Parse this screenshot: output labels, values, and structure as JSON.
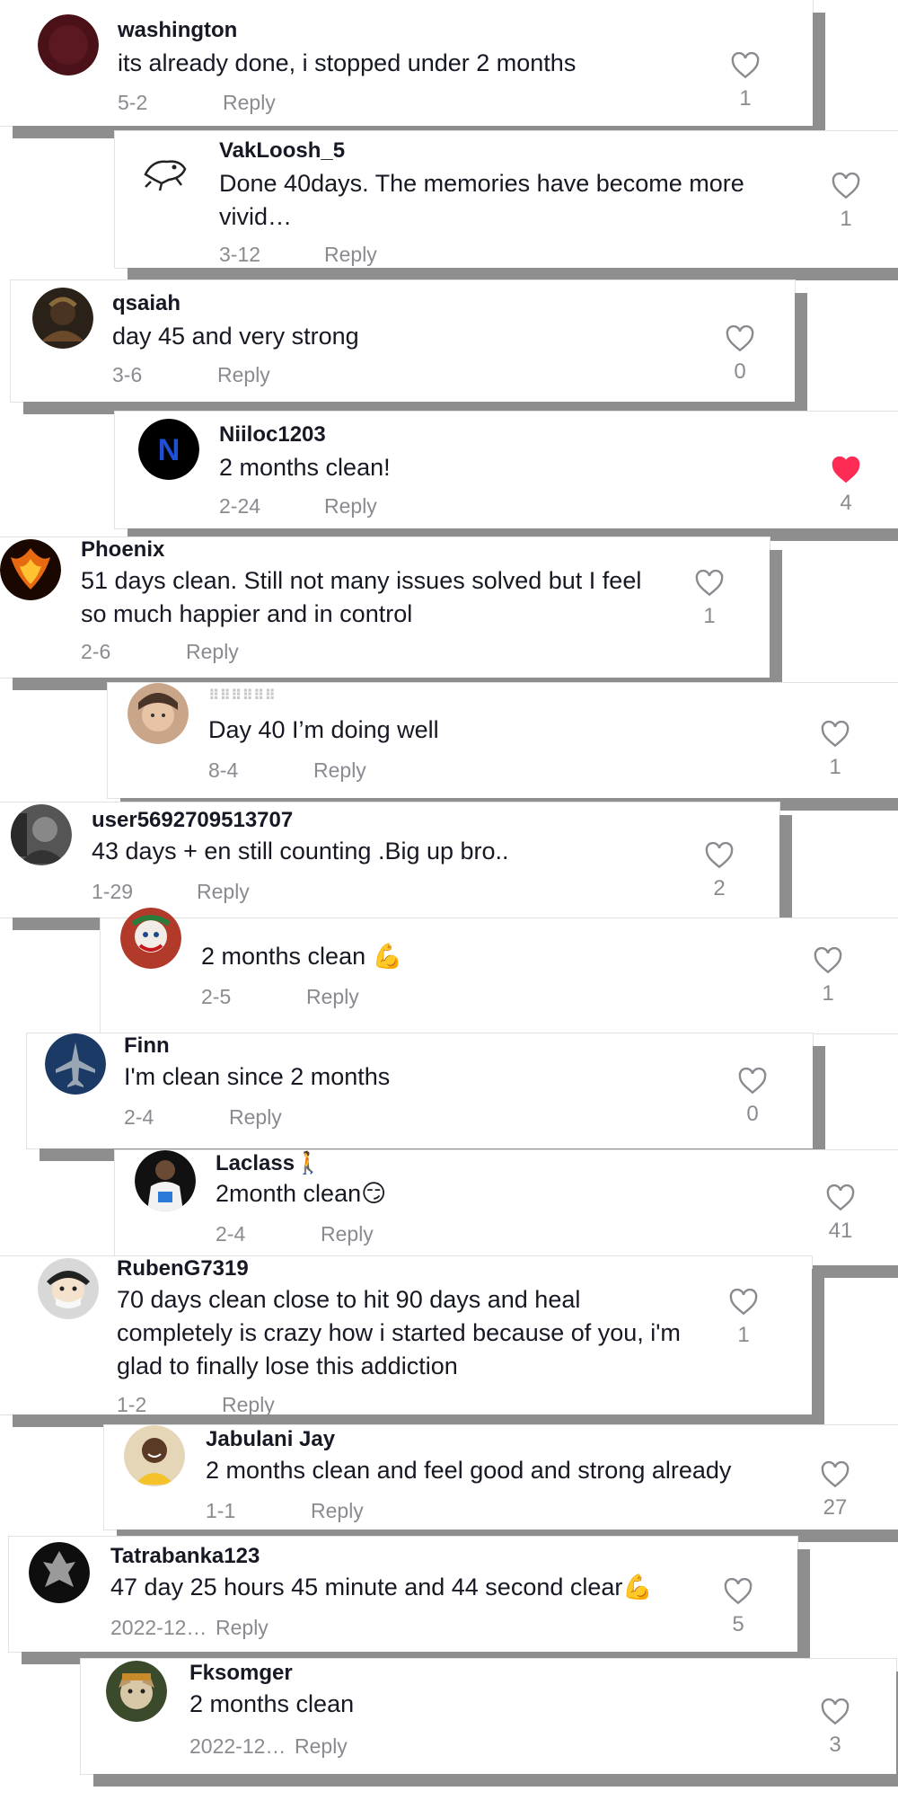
{
  "comments": [
    {
      "username": "washington",
      "text": "its already done, i stopped under 2 months",
      "date": "5-2",
      "reply": "Reply",
      "likes": "1",
      "liked": false,
      "avatar": "avatar-dark-red"
    },
    {
      "username": "VakLoosh_5",
      "text": "Done 40days. The memories have become more vivid…",
      "date": "3-12",
      "reply": "Reply",
      "likes": "1",
      "liked": false,
      "avatar": "avatar-frog-sketch"
    },
    {
      "username": "qsaiah",
      "text": "day 45 and very strong",
      "date": "3-6",
      "reply": "Reply",
      "likes": "0",
      "liked": false,
      "avatar": "avatar-person-photo"
    },
    {
      "username": "Niiloc1203",
      "text": "2 months clean!",
      "date": "2-24",
      "reply": "Reply",
      "likes": "4",
      "liked": true,
      "avatar": "avatar-letter-n"
    },
    {
      "username": "Phoenix",
      "text": "51 days clean. Still not many issues solved but I feel so much happier and in control",
      "date": "2-6",
      "reply": "Reply",
      "likes": "1",
      "liked": false,
      "avatar": "avatar-phoenix"
    },
    {
      "username": "⠿⠿⠿⠿⠿⠿",
      "text": "Day 40 I’m doing well",
      "date": "8-4",
      "reply": "Reply",
      "likes": "1",
      "liked": false,
      "avatar": "avatar-selfie"
    },
    {
      "username": "user5692709513707",
      "text": "43 days + en still counting .Big up bro..",
      "date": "1-29",
      "reply": "Reply",
      "likes": "2",
      "liked": false,
      "avatar": "avatar-bw-photo"
    },
    {
      "username": "",
      "text": "2 months clean 💪",
      "date": "2-5",
      "reply": "Reply",
      "likes": "1",
      "liked": false,
      "avatar": "avatar-joker"
    },
    {
      "username": "Finn",
      "text": "I'm clean since 2 months",
      "date": "2-4",
      "reply": "Reply",
      "likes": "0",
      "liked": false,
      "avatar": "avatar-jet"
    },
    {
      "username": "Laclass🚶",
      "text": "2month clean😏",
      "date": "2-4",
      "reply": "Reply",
      "likes": "41",
      "liked": false,
      "avatar": "avatar-jersey"
    },
    {
      "username": "RubenG7319",
      "text": "70 days clean close to hit 90 days and heal completely is crazy how i started because of you, i'm glad to finally lose this addiction",
      "date": "1-2",
      "reply": "Reply",
      "likes": "1",
      "liked": false,
      "avatar": "avatar-anime"
    },
    {
      "username": "Jabulani Jay",
      "text": "2 months clean and feel good and strong already",
      "date": "1-1",
      "reply": "Reply",
      "likes": "27",
      "liked": false,
      "avatar": "avatar-smiling-man"
    },
    {
      "username": "Tatrabanka123",
      "text": "47 day 25 hours 45 minute and 44 second clear💪",
      "date": "2022-12…",
      "reply": "Reply",
      "likes": "5",
      "liked": false,
      "avatar": "avatar-dark-figure"
    },
    {
      "username": "Fksomger",
      "text": "2 months clean",
      "date": "2022-12…",
      "reply": "Reply",
      "likes": "3",
      "liked": false,
      "avatar": "avatar-dog"
    }
  ],
  "colors": {
    "liked": "#fe2c55",
    "muted": "#8a8b91",
    "text": "#161823"
  }
}
